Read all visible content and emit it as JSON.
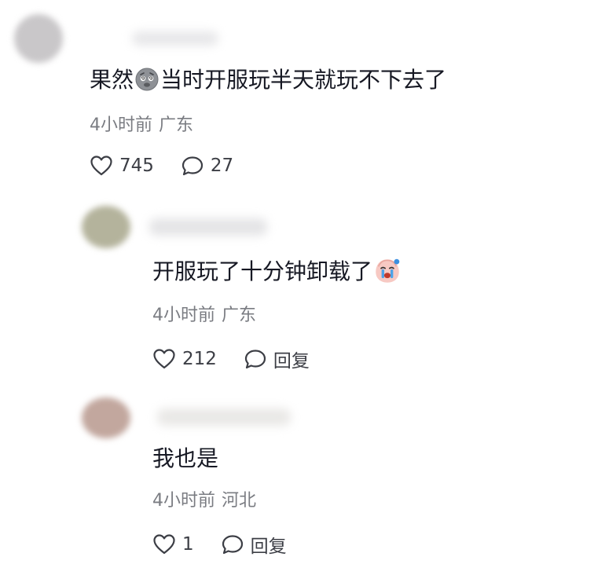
{
  "comments": [
    {
      "text_before_emoji": "果然",
      "emoji": "dizzy-face-emoji",
      "text_after_emoji": "当时开服玩半天就玩不下去了",
      "time": "4小时前",
      "location": "广东",
      "likes": "745",
      "reply_label": "27"
    },
    {
      "text_before_emoji": "开服玩了十分钟卸载了",
      "emoji": "crying-face-emoji",
      "text_after_emoji": "",
      "time": "4小时前",
      "location": "广东",
      "likes": "212",
      "reply_label": "回复"
    },
    {
      "text_before_emoji": "我也是",
      "emoji": "",
      "text_after_emoji": "",
      "time": "4小时前",
      "location": "河北",
      "likes": "1",
      "reply_label": "回复"
    }
  ],
  "colors": {
    "text": "#161823",
    "meta": "#7a7c82",
    "icon": "#3c3e45"
  }
}
